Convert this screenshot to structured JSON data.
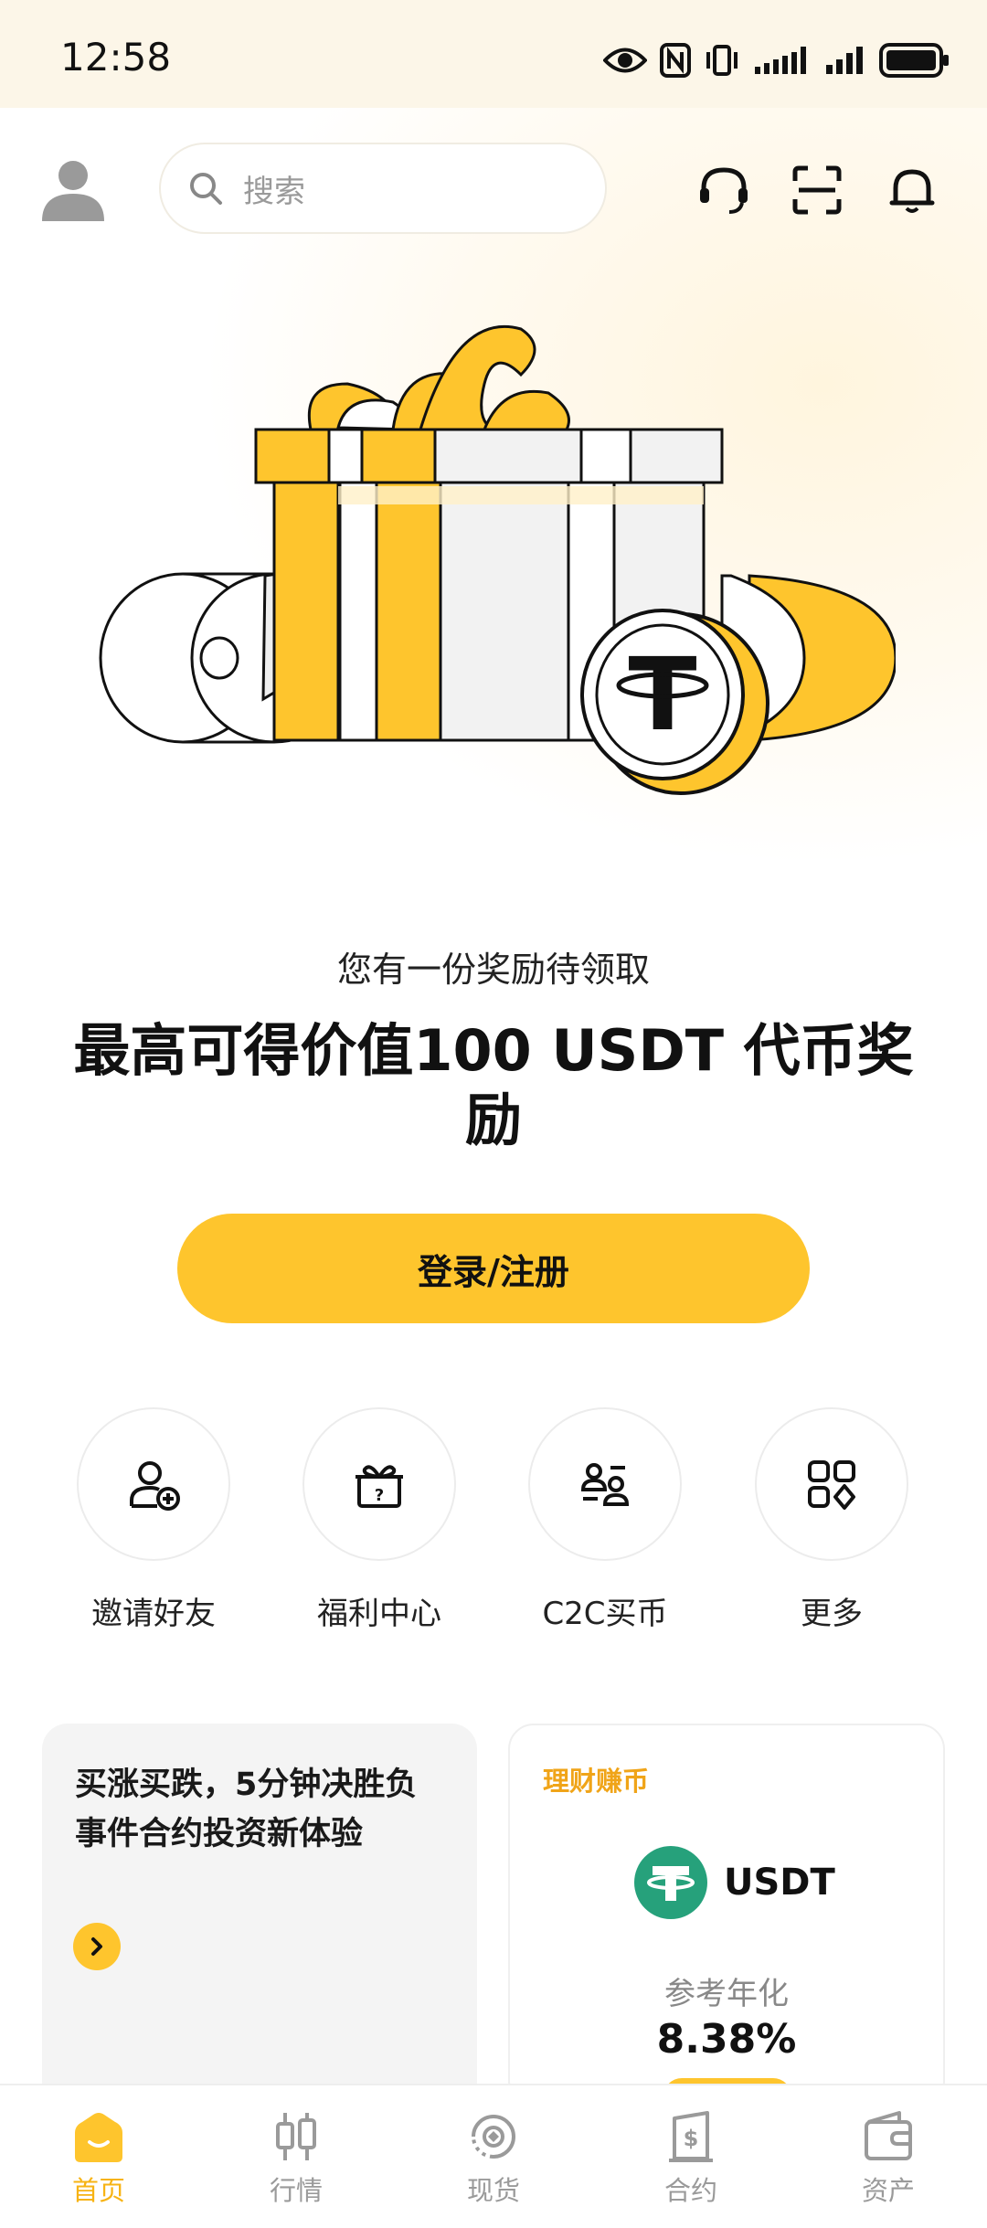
{
  "status_bar": {
    "time": "12:58"
  },
  "search": {
    "placeholder": "搜索"
  },
  "reward": {
    "subtitle": "您有一份奖励待领取",
    "title": "最高可得价值100 USDT 代币奖励",
    "login_label": "登录/注册"
  },
  "quick_actions": [
    {
      "label": "邀请好友",
      "icon": "invite-user-icon"
    },
    {
      "label": "福利中心",
      "icon": "gift-box-icon"
    },
    {
      "label": "C2C买币",
      "icon": "c2c-icon"
    },
    {
      "label": "更多",
      "icon": "more-grid-icon"
    }
  ],
  "promo_card": {
    "text": "买涨买跌，5分钟决胜负事件合约投资新体验"
  },
  "earn_card": {
    "tag": "理财赚币",
    "coin": "USDT",
    "label": "参考年化",
    "rate": "8.38%"
  },
  "tabs": [
    {
      "label": "首页",
      "active": true
    },
    {
      "label": "行情",
      "active": false
    },
    {
      "label": "现货",
      "active": false
    },
    {
      "label": "合约",
      "active": false
    },
    {
      "label": "资产",
      "active": false
    }
  ],
  "colors": {
    "accent": "#fec52d",
    "accent_text": "#f7b313",
    "usdt_green": "#26a17b"
  }
}
